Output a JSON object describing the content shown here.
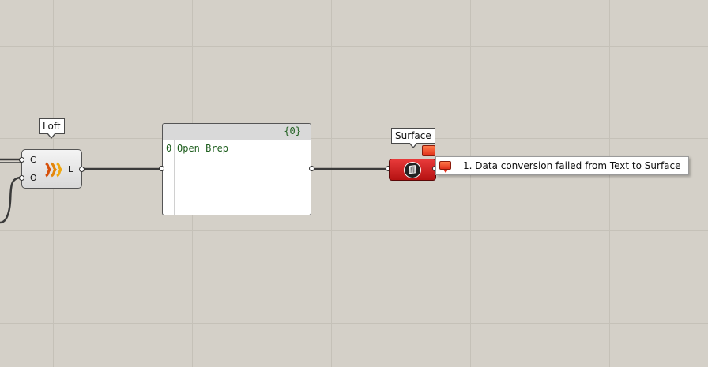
{
  "canvas": {
    "background": "#d4d0c8",
    "grid_color": "#c5c1b8"
  },
  "loft_component": {
    "tooltip": "Loft",
    "input_curves_label": "C",
    "input_options_label": "O",
    "output_label": "L",
    "icon": "loft-icon"
  },
  "panel": {
    "path_label": "{0}",
    "rows": [
      {
        "index": "0",
        "value": "Open Brep"
      }
    ]
  },
  "surface_param": {
    "tooltip": "Surface",
    "state": "error",
    "state_color": "#d42020",
    "icon": "surface-icon"
  },
  "error_balloon": {
    "message": "1. Data conversion failed from Text to Surface",
    "icon": "error-message-icon"
  }
}
